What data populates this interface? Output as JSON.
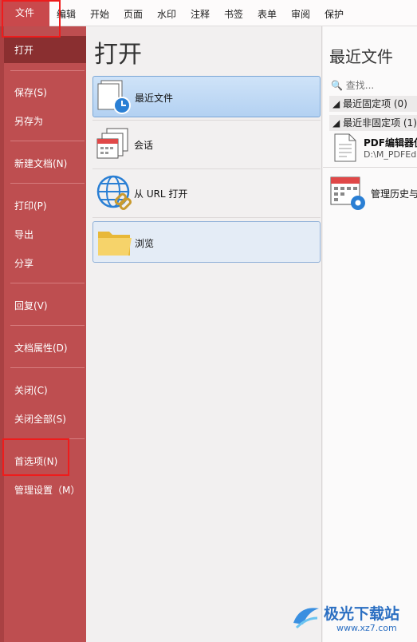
{
  "menubar": {
    "tabs": [
      "文件",
      "编辑",
      "开始",
      "页面",
      "水印",
      "注释",
      "书签",
      "表单",
      "审阅",
      "保护"
    ]
  },
  "sidebar": {
    "items": [
      "打开",
      "保存(S)",
      "另存为",
      "新建文档(N)",
      "打印(P)",
      "导出",
      "分享",
      "回复(V)",
      "文档属性(D)",
      "关闭(C)",
      "关闭全部(S)",
      "首选项(N)",
      "管理设置（M）"
    ]
  },
  "open_panel": {
    "title": "打开",
    "buttons": [
      "最近文件",
      "会话",
      "从 URL 打开",
      "浏览"
    ]
  },
  "recent_panel": {
    "title": "最近文件",
    "search_placeholder": "查找...",
    "pinned_group": "最近固定项 (0)",
    "unpinned_group": "最近非固定项 (1)",
    "file_name": "PDF编辑器使",
    "file_path": "D:\\M_PDFEd",
    "manage_label": "管理历史与"
  },
  "watermark": {
    "text": "极光下载站",
    "url": "www.xz7.com"
  },
  "colors": {
    "sidebar": "#be4e50",
    "sidebar_active": "#8a2f30",
    "highlight_box": "#ee1c1c",
    "selected_button": "#b3d1f2"
  }
}
